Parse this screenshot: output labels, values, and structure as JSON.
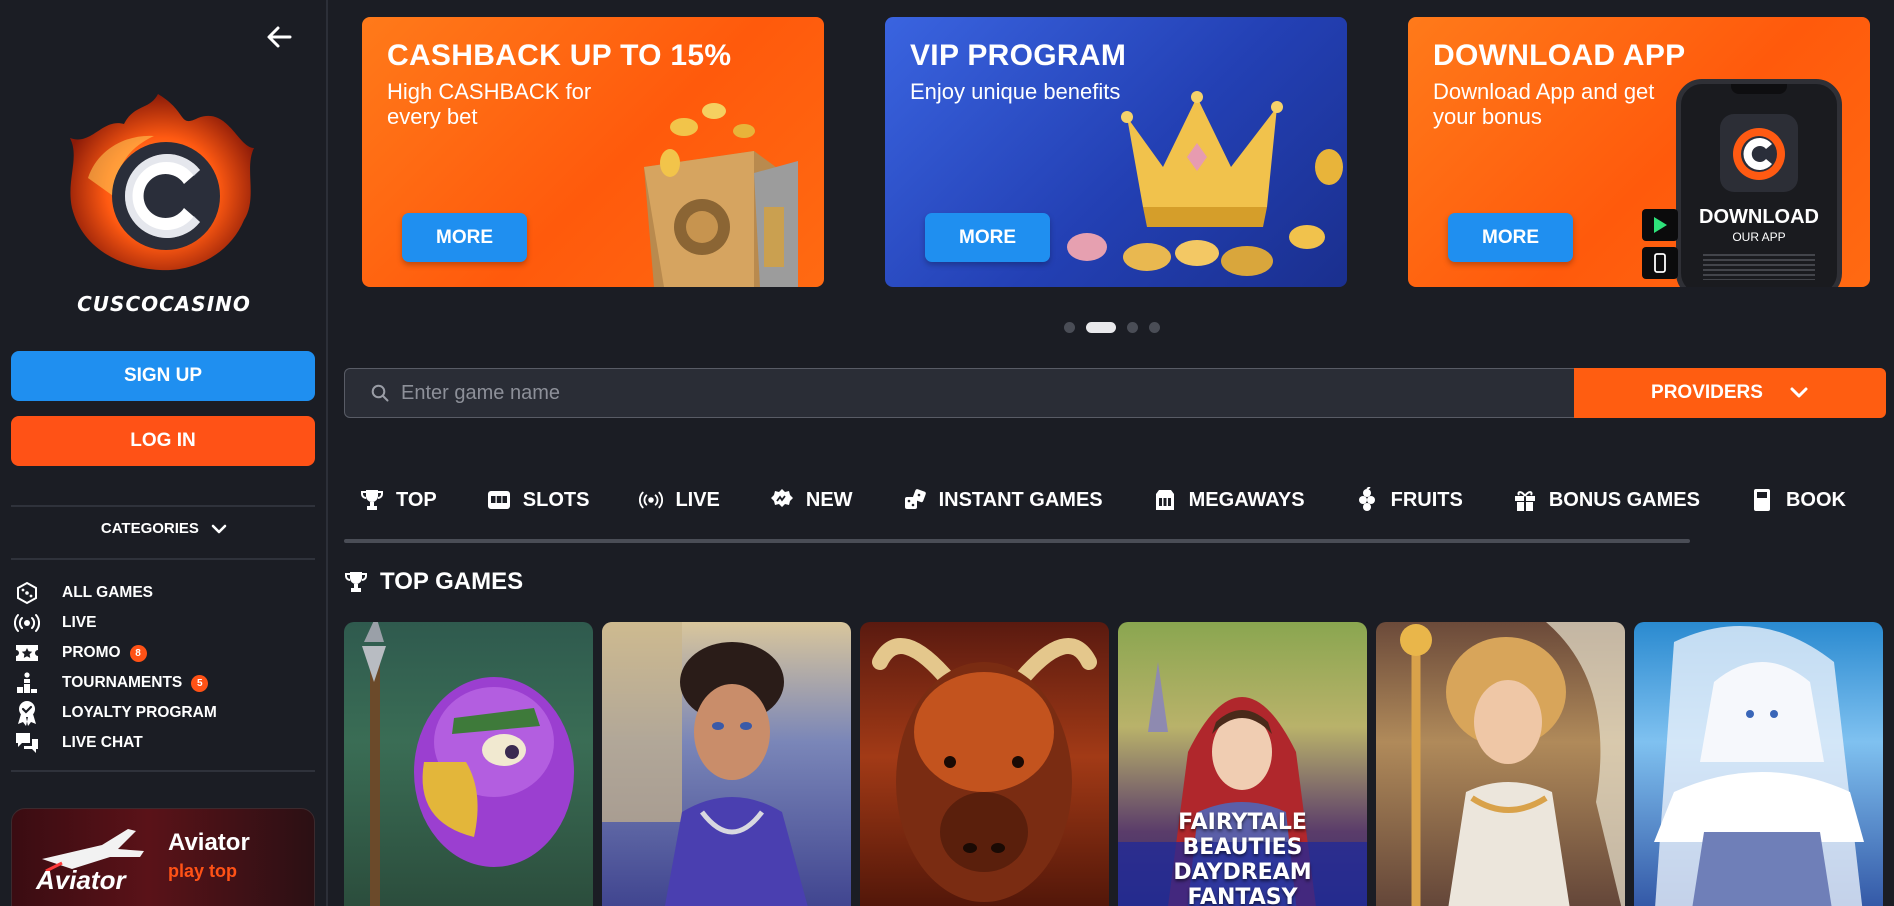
{
  "brand": {
    "name": "CUSCOCASINO"
  },
  "auth": {
    "signup_label": "SIGN UP",
    "login_label": "LOG IN"
  },
  "sidebar": {
    "categories_label": "CATEGORIES",
    "items": [
      {
        "label": "ALL GAMES",
        "icon": "dice-icon"
      },
      {
        "label": "LIVE",
        "icon": "broadcast-icon"
      },
      {
        "label": "PROMO",
        "icon": "ticket-star-icon",
        "badge": "8"
      },
      {
        "label": "TOURNAMENTS",
        "icon": "podium-icon",
        "badge": "5"
      },
      {
        "label": "LOYALTY PROGRAM",
        "icon": "award-icon"
      },
      {
        "label": "LIVE CHAT",
        "icon": "chat-icon"
      }
    ],
    "promo_card": {
      "title": "Aviator",
      "subtitle": "play top",
      "logo_text": "Aviator"
    }
  },
  "banners": [
    {
      "title": "CASHBACK UP TO 15%",
      "subtitle": "High CASHBACK for every bet",
      "button": "MORE"
    },
    {
      "title": "VIP PROGRAM",
      "subtitle": "Enjoy unique benefits",
      "button": "MORE"
    },
    {
      "title": "DOWNLOAD APP",
      "subtitle": "Download App and get your bonus",
      "button": "MORE",
      "phone_title": "DOWNLOAD",
      "phone_sub": "OUR APP"
    }
  ],
  "carousel": {
    "count": 4,
    "active": 1
  },
  "search": {
    "placeholder": "Enter game name",
    "value": ""
  },
  "providers_label": "PROVIDERS",
  "tabs": [
    {
      "label": "TOP",
      "icon": "trophy-icon"
    },
    {
      "label": "SLOTS",
      "icon": "slot-machine-icon"
    },
    {
      "label": "LIVE",
      "icon": "broadcast-icon"
    },
    {
      "label": "NEW",
      "icon": "new-badge-icon"
    },
    {
      "label": "INSTANT GAMES",
      "icon": "dice-icon"
    },
    {
      "label": "MEGAWAYS",
      "icon": "megaways-icon"
    },
    {
      "label": "FRUITS",
      "icon": "fruit-icon"
    },
    {
      "label": "BONUS GAMES",
      "icon": "gift-icon"
    },
    {
      "label": "BOOK",
      "icon": "book-icon"
    }
  ],
  "top_games": {
    "title": "TOP GAMES",
    "games": [
      {
        "caption": ""
      },
      {
        "caption": ""
      },
      {
        "caption": ""
      },
      {
        "caption": "FAIRYTALE BEAUTIES DAYDREAM FANTASY"
      },
      {
        "caption": ""
      },
      {
        "caption": ""
      }
    ]
  },
  "colors": {
    "accent_orange": "#ff5216",
    "accent_blue": "#1f8ff0",
    "background": "#1b1d24"
  }
}
